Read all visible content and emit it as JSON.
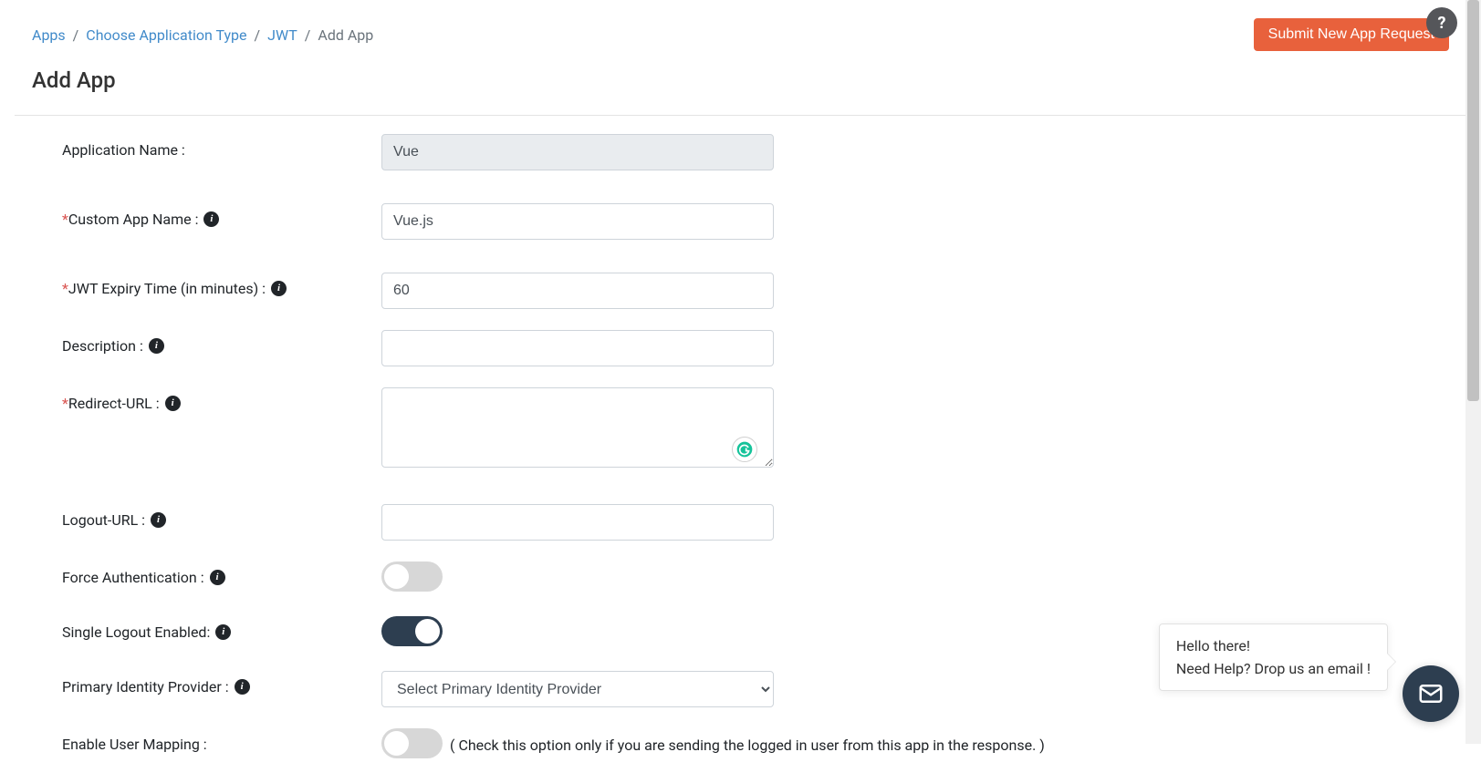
{
  "breadcrumb": {
    "items": [
      {
        "label": "Apps"
      },
      {
        "label": "Choose Application Type"
      },
      {
        "label": "JWT"
      }
    ],
    "current": "Add App"
  },
  "header": {
    "submit_button": "Submit New App Request",
    "page_title": "Add App"
  },
  "form": {
    "app_name": {
      "label": "Application Name :",
      "value": "Vue"
    },
    "custom_app_name": {
      "label": "Custom App Name :",
      "value": "Vue.js"
    },
    "jwt_expiry": {
      "label": "JWT Expiry Time (in minutes) :",
      "value": "60"
    },
    "description": {
      "label": "Description :",
      "value": ""
    },
    "redirect_url": {
      "label": "Redirect-URL :",
      "value": ""
    },
    "logout_url": {
      "label": "Logout-URL :",
      "value": ""
    },
    "force_auth": {
      "label": "Force Authentication :"
    },
    "single_logout": {
      "label": "Single Logout Enabled:"
    },
    "primary_idp": {
      "label": "Primary Identity Provider :",
      "selected": "Select Primary Identity Provider"
    },
    "user_mapping": {
      "label": "Enable User Mapping :",
      "hint": "( Check this option only if you are sending the logged in user from this app in the response. )"
    }
  },
  "chat": {
    "line1": "Hello there!",
    "line2": "Need Help? Drop us an email !"
  },
  "help_icon": "?"
}
